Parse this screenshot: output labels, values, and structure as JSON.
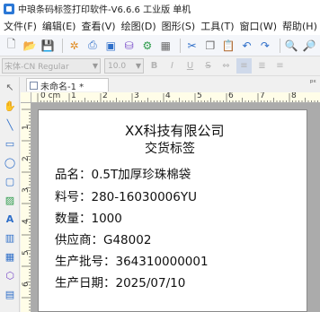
{
  "window": {
    "title": "中琅条码标签打印软件-V6.6.6 工业版 单机"
  },
  "menu": [
    "文件(F)",
    "编辑(E)",
    "查看(V)",
    "绘图(D)",
    "图形(S)",
    "工具(T)",
    "窗口(W)",
    "帮助(H)"
  ],
  "format_bar": {
    "font_name": "宋体-CN Regular",
    "font_size": "10.0"
  },
  "tab": {
    "label": "未命名-1 *",
    "pin": "ᵖᵋ"
  },
  "ruler": {
    "h_labels": [
      "0 cm",
      "1",
      "2",
      "3",
      "4",
      "5",
      "6",
      "7",
      "8"
    ],
    "v_labels": [
      "1",
      "2",
      "3",
      "4",
      "5",
      "6"
    ]
  },
  "label": {
    "company": "XX科技有限公司",
    "heading": "交货标签",
    "fields": [
      "品名：0.5T加厚珍珠棉袋",
      "料号：280-16030006YU",
      "数量：1000",
      "供应商：G48002",
      "生产批号：364310000001",
      "生产日期：2025/07/10"
    ]
  },
  "colors": {
    "accent": "#2b78d6",
    "canvas_bg": "#ababab",
    "ruler_bg": "#fffde8"
  }
}
